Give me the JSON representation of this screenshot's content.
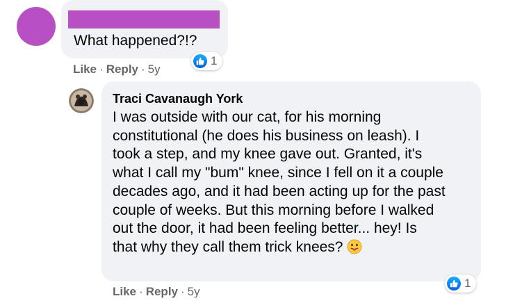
{
  "comment1": {
    "text": "What happened?!?",
    "reaction_count": "1",
    "actions": {
      "like": "Like",
      "reply": "Reply",
      "separator": "·",
      "time": "5y"
    }
  },
  "comment2": {
    "author": "Traci Cavanaugh York",
    "lines": [
      "I was outside with our cat, for his morning",
      "constitutional (he does his business on leash). I",
      "took a step, and my knee gave out. Granted, it's",
      "what I call my \"bum\" knee, since I fell on it a couple",
      "decades ago, and it had been acting up for the past",
      "couple of weeks. But this morning before I walked",
      "out the door, it had been feeling better... hey! Is",
      "that why they call them trick knees?"
    ],
    "emoji": "tongue-out-emoji",
    "reaction_count": "1",
    "actions": {
      "like": "Like",
      "reply": "Reply",
      "separator": "·",
      "time": "5y"
    }
  },
  "colors": {
    "avatar1": "#b84fc3",
    "bubble": "#f0f2f5",
    "meta": "#65676b",
    "like_blue": "#0866ff"
  }
}
